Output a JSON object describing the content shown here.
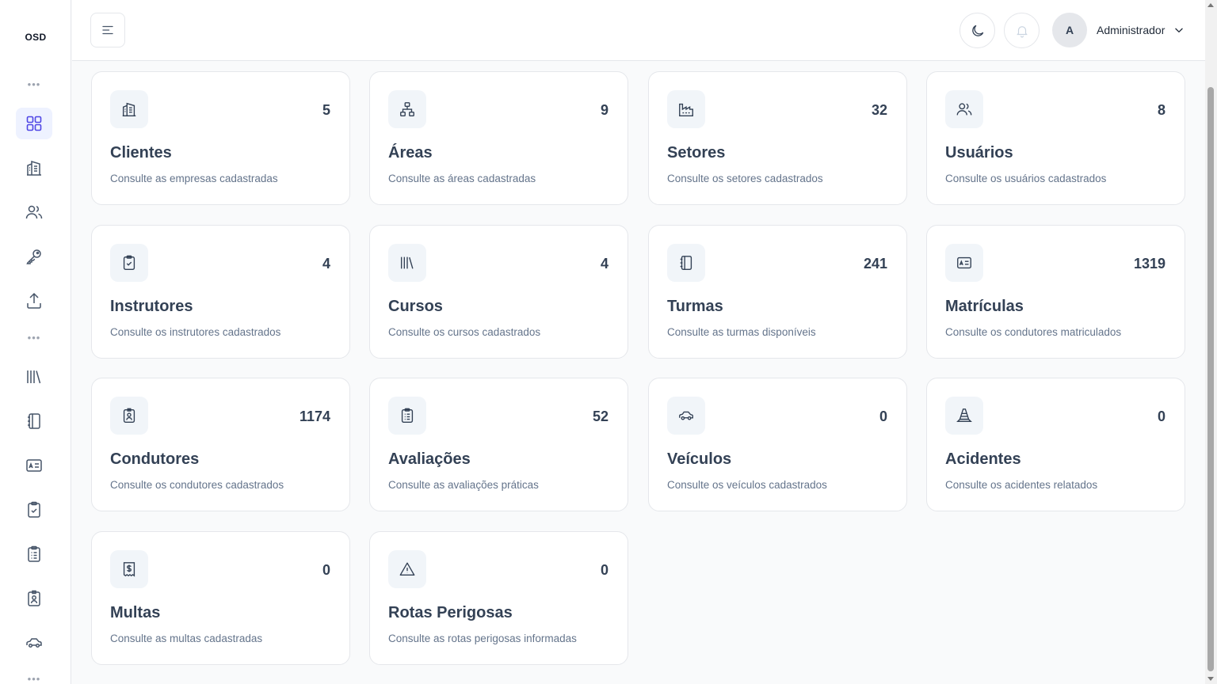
{
  "app": {
    "logo": "OSD"
  },
  "sidebar": {
    "items": [
      {
        "icon": "dashboard-grid-icon",
        "active": true
      },
      {
        "icon": "building-icon"
      },
      {
        "icon": "users-icon"
      },
      {
        "icon": "key-icon"
      },
      {
        "icon": "upload-icon"
      },
      {
        "icon": "library-books-icon"
      },
      {
        "icon": "notebook-icon"
      },
      {
        "icon": "id-card-icon"
      },
      {
        "icon": "clipboard-check-icon"
      },
      {
        "icon": "clipboard-list-icon"
      },
      {
        "icon": "id-badge-icon"
      },
      {
        "icon": "car-icon"
      }
    ]
  },
  "header": {
    "user": {
      "initial": "A",
      "name": "Administrador"
    }
  },
  "cards": [
    {
      "title": "Clientes",
      "count": "5",
      "desc": "Consulte as empresas cadastradas",
      "icon": "building-icon"
    },
    {
      "title": "Áreas",
      "count": "9",
      "desc": "Consulte as áreas cadastradas",
      "icon": "sitemap-icon"
    },
    {
      "title": "Setores",
      "count": "32",
      "desc": "Consulte os setores cadastrados",
      "icon": "factory-icon"
    },
    {
      "title": "Usuários",
      "count": "8",
      "desc": "Consulte os usuários cadastrados",
      "icon": "users-icon"
    },
    {
      "title": "Instrutores",
      "count": "4",
      "desc": "Consulte os instrutores cadastrados",
      "icon": "clipboard-check-icon"
    },
    {
      "title": "Cursos",
      "count": "4",
      "desc": "Consulte os cursos cadastrados",
      "icon": "library-books-icon"
    },
    {
      "title": "Turmas",
      "count": "241",
      "desc": "Consulte as turmas disponíveis",
      "icon": "notebook-icon"
    },
    {
      "title": "Matrículas",
      "count": "1319",
      "desc": "Consulte os condutores matriculados",
      "icon": "id-card-icon"
    },
    {
      "title": "Condutores",
      "count": "1174",
      "desc": "Consulte os condutores cadastrados",
      "icon": "id-badge-icon"
    },
    {
      "title": "Avaliações",
      "count": "52",
      "desc": "Consulte as avaliações práticas",
      "icon": "clipboard-list-icon"
    },
    {
      "title": "Veículos",
      "count": "0",
      "desc": "Consulte os veículos cadastrados",
      "icon": "car-icon"
    },
    {
      "title": "Acidentes",
      "count": "0",
      "desc": "Consulte os acidentes relatados",
      "icon": "traffic-cone-icon"
    },
    {
      "title": "Multas",
      "count": "0",
      "desc": "Consulte as multas cadastradas",
      "icon": "receipt-dollar-icon"
    },
    {
      "title": "Rotas Perigosas",
      "count": "0",
      "desc": "Consulte as rotas perigosas informadas",
      "icon": "warning-triangle-icon"
    }
  ]
}
